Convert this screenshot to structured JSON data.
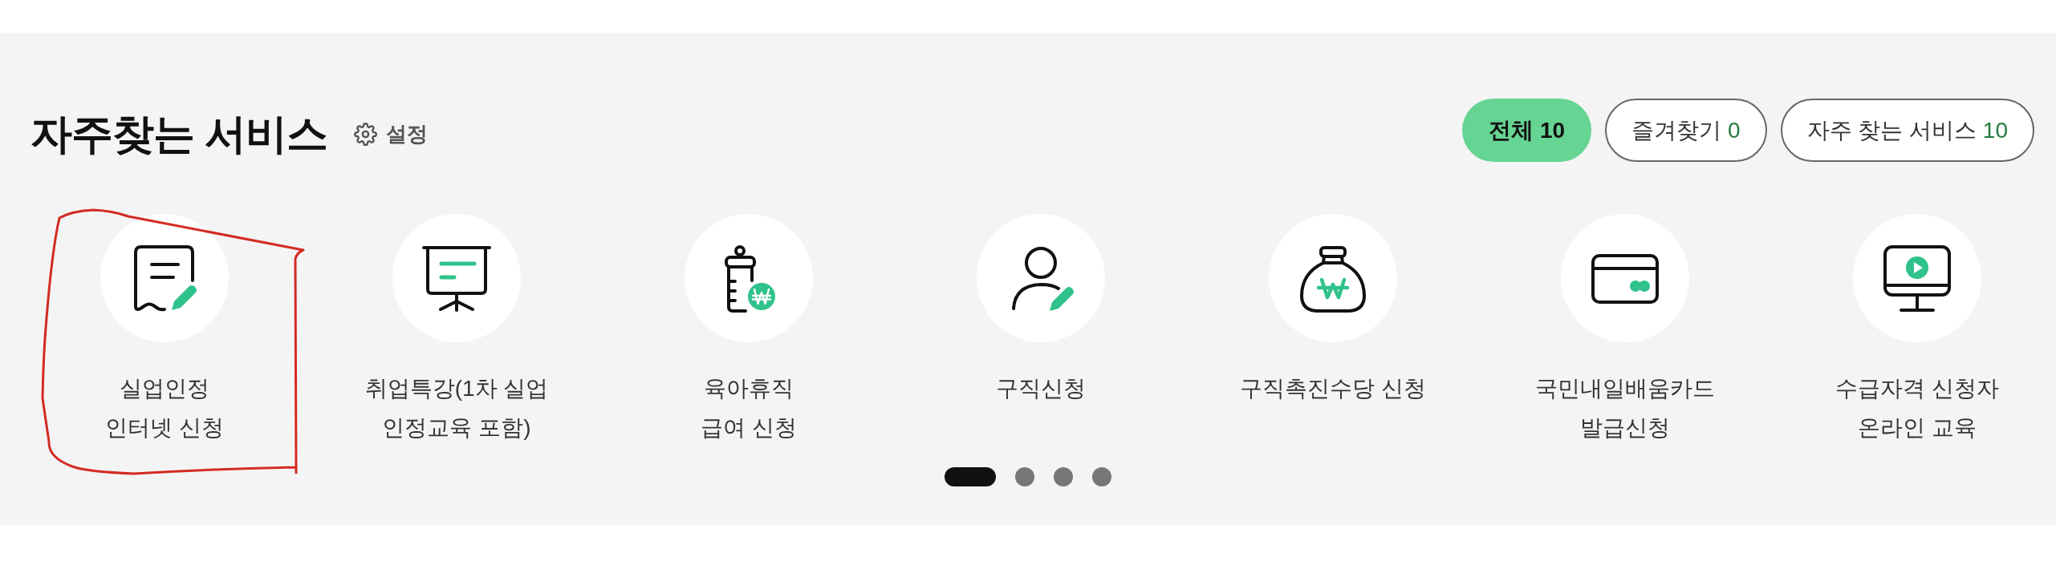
{
  "section": {
    "title": "자주찾는 서비스",
    "settings": "설정"
  },
  "filters": [
    {
      "label": "전체",
      "count": "10",
      "selected": true
    },
    {
      "label": "즐겨찾기",
      "count": "0",
      "selected": false
    },
    {
      "label": "자주 찾는 서비스",
      "count": "10",
      "selected": false
    }
  ],
  "services": [
    {
      "label": "실업인정\n인터넷 신청",
      "highlighted": true
    },
    {
      "label": "취업특강(1차 실업\n인정교육 포함)",
      "highlighted": false
    },
    {
      "label": "육아휴직\n급여 신청",
      "highlighted": false
    },
    {
      "label": "구직신청",
      "highlighted": false
    },
    {
      "label": "구직촉진수당 신청",
      "highlighted": false
    },
    {
      "label": "국민내일배움카드\n발급신청",
      "highlighted": false
    },
    {
      "label": "수급자격 신청자\n온라인 교육",
      "highlighted": false
    }
  ],
  "pagination": [
    {
      "selected": true
    },
    {
      "selected": false
    },
    {
      "selected": false
    },
    {
      "selected": false
    }
  ]
}
